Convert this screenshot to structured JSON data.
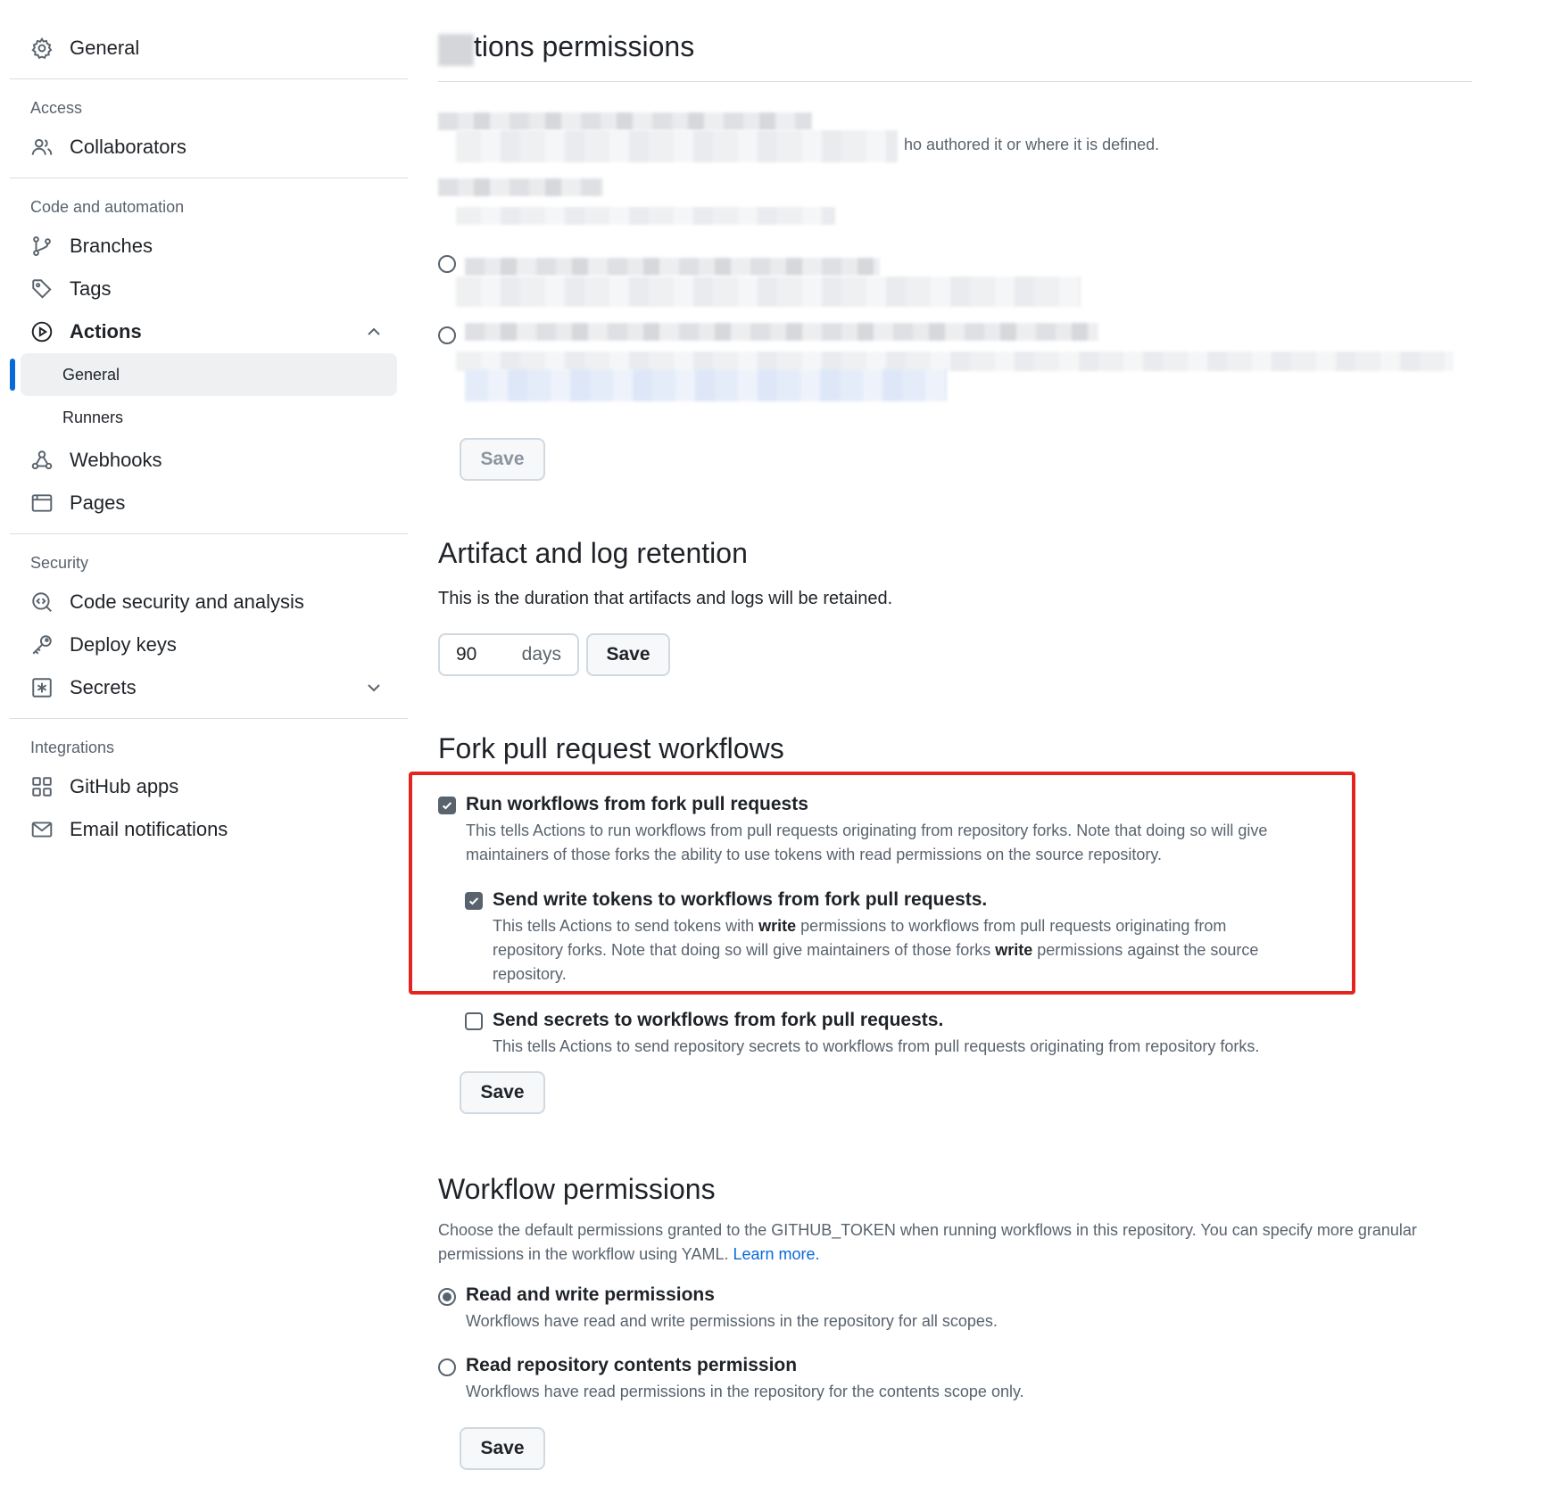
{
  "sidebar": {
    "general": "General",
    "groups": {
      "access": "Access",
      "code": "Code and automation",
      "security": "Security",
      "integrations": "Integrations"
    },
    "items": {
      "collaborators": "Collaborators",
      "branches": "Branches",
      "tags": "Tags",
      "actions": "Actions",
      "actions_general": "General",
      "actions_runners": "Runners",
      "webhooks": "Webhooks",
      "pages": "Pages",
      "code_security": "Code security and analysis",
      "deploy_keys": "Deploy keys",
      "secrets": "Secrets",
      "github_apps": "GitHub apps",
      "email_notifications": "Email notifications"
    }
  },
  "actions_permissions": {
    "title_visible": "tions permissions",
    "partial_desc": "ho authored it or where it is defined.",
    "save_label": "Save"
  },
  "artifact": {
    "title": "Artifact and log retention",
    "desc": "This is the duration that artifacts and logs will be retained.",
    "days_value": "90",
    "days_unit": "days",
    "save_label": "Save"
  },
  "fork": {
    "title": "Fork pull request workflows",
    "run": {
      "label": "Run workflows from fork pull requests",
      "desc1": "This tells Actions to run workflows from pull requests originating from repository forks. Note that doing so will give",
      "desc2": "maintainers of those forks the ability to use tokens with read permissions on the source repository.",
      "checked": true
    },
    "write_tokens": {
      "label": "Send write tokens to workflows from fork pull requests.",
      "desc1_a": "This tells Actions to send tokens with ",
      "desc1_b": "write",
      "desc1_c": " permissions to workflows from pull requests originating from",
      "desc2_a": "repository forks. Note that doing so will give maintainers of those forks ",
      "desc2_b": "write",
      "desc2_c": " permissions against the source",
      "desc3": "repository.",
      "checked": true
    },
    "secrets": {
      "label": "Send secrets to workflows from fork pull requests.",
      "desc": "This tells Actions to send repository secrets to workflows from pull requests originating from repository forks.",
      "checked": false
    },
    "save_label": "Save",
    "highlight_color": "#e5241f"
  },
  "workflow": {
    "title": "Workflow permissions",
    "desc1": "Choose the default permissions granted to the GITHUB_TOKEN when running workflows in this repository. You can specify more granular",
    "desc2": "permissions in the workflow using YAML. ",
    "learn_more": "Learn more.",
    "read_write": {
      "label": "Read and write permissions",
      "desc": "Workflows have read and write permissions in the repository for all scopes.",
      "selected": true
    },
    "read_only": {
      "label": "Read repository contents permission",
      "desc": "Workflows have read permissions in the repository for the contents scope only.",
      "selected": false
    },
    "save_label": "Save"
  },
  "colors": {
    "accent": "#0969da",
    "text": "#1f2328",
    "muted": "#59636e",
    "border": "#d1d9e0"
  }
}
